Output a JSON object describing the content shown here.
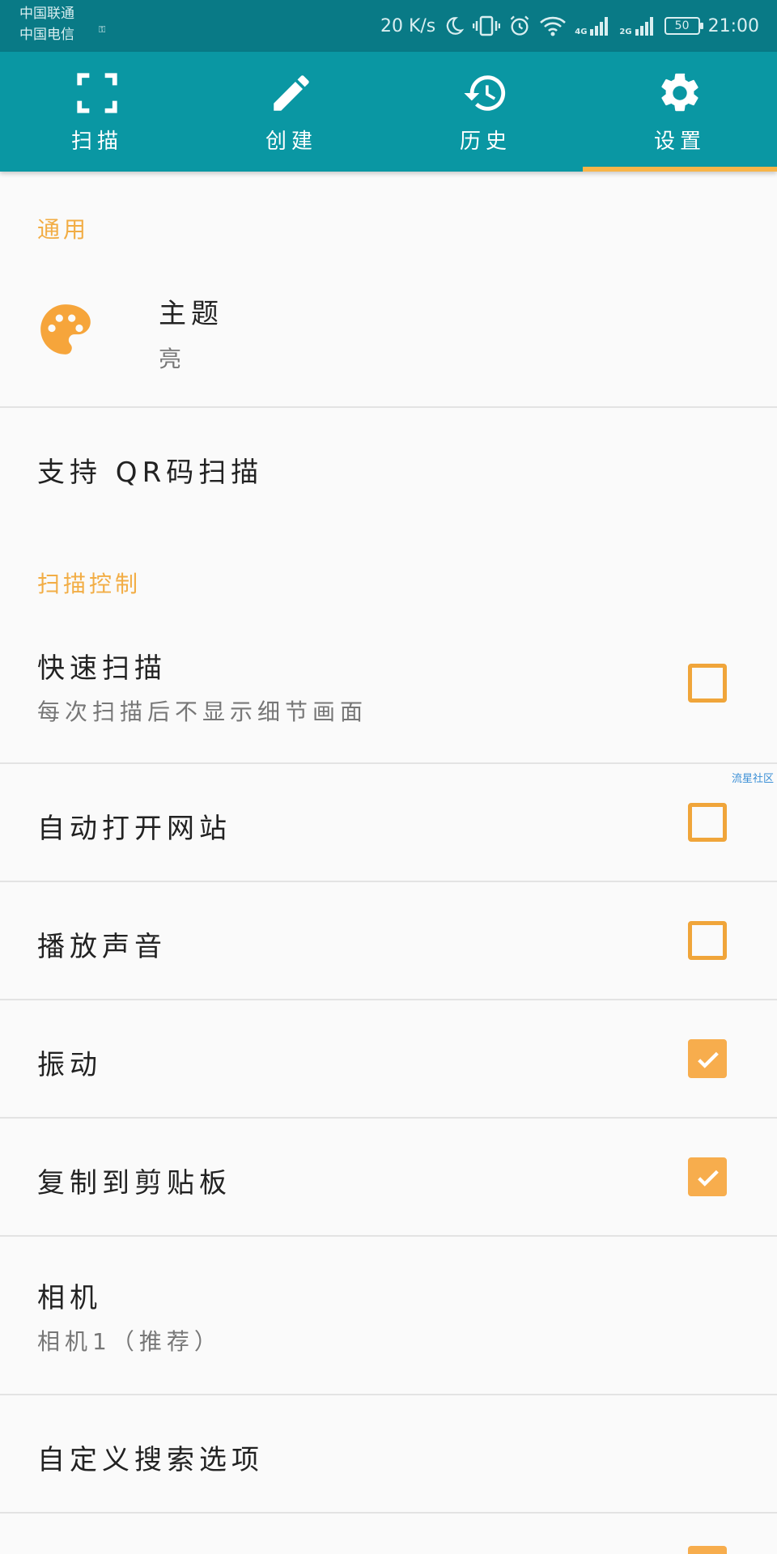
{
  "status_bar": {
    "carrier_1": "中国联通",
    "carrier_2": "中国电信",
    "net_speed": "20 K/s",
    "net_4g": "4G",
    "net_2g": "2G",
    "battery": "50",
    "time": "21:00"
  },
  "tabs": [
    {
      "label": "扫描",
      "icon": "scan-frame-icon",
      "active": false
    },
    {
      "label": "创建",
      "icon": "pencil-icon",
      "active": false
    },
    {
      "label": "历史",
      "icon": "history-icon",
      "active": false
    },
    {
      "label": "设置",
      "icon": "gear-icon",
      "active": true
    }
  ],
  "sections": {
    "general": "通用",
    "scan_control": "扫描控制"
  },
  "settings": {
    "theme": {
      "title": "主题",
      "summary": "亮",
      "icon": "palette-icon"
    },
    "qr_support": {
      "title": "支持 QR码扫描"
    },
    "quick_scan": {
      "title": "快速扫描",
      "summary": "每次扫描后不显示细节画面",
      "checked": false
    },
    "auto_open": {
      "title": "自动打开网站",
      "checked": false
    },
    "play_sound": {
      "title": "播放声音",
      "checked": false
    },
    "vibrate": {
      "title": "振动",
      "checked": true
    },
    "copy_clipboard": {
      "title": "复制到剪贴板",
      "checked": true
    },
    "camera": {
      "title": "相机",
      "summary": "相机1（推荐）"
    },
    "custom_search": {
      "title": "自定义搜索选项"
    }
  },
  "watermark": "流星社区",
  "colors": {
    "status_bar": "#097a86",
    "tab_bar": "#0a97a3",
    "accent": "#f2ad45",
    "tab_indicator": "#f7b548"
  }
}
